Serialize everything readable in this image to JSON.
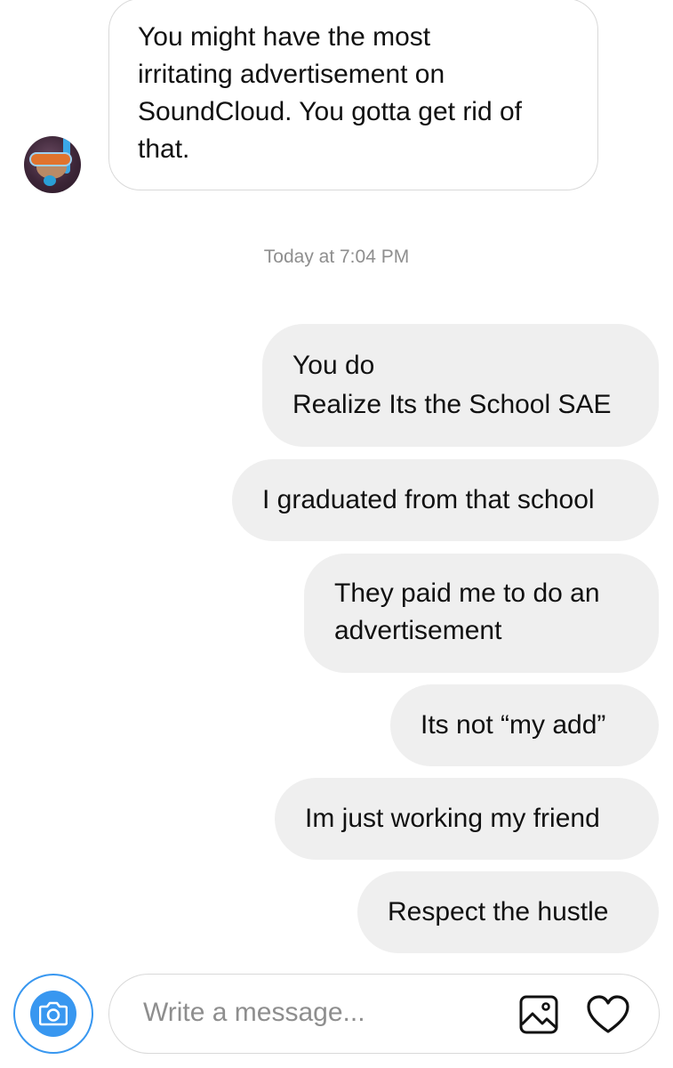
{
  "conversation": {
    "incoming": {
      "text": "You might have the most\nirritating advertisement on\nSoundCloud. You gotta get rid of\nthat.",
      "avatar": "user-avatar-snorkel"
    },
    "timestamp": "Today at 7:04 PM",
    "outgoing": [
      {
        "text": "You do\nRealize Its the School SAE"
      },
      {
        "text": "I graduated from that school"
      },
      {
        "text": "They paid me to do an\nadvertisement"
      },
      {
        "text": "Its not “my add”"
      },
      {
        "text": "Im just working my friend"
      },
      {
        "text": "Respect the hustle"
      }
    ]
  },
  "composer": {
    "placeholder": "Write a message...",
    "camera_icon": "camera-icon",
    "gallery_icon": "image-icon",
    "like_icon": "heart-icon"
  },
  "colors": {
    "accent": "#3897f0",
    "bubble_out": "#efefef",
    "border": "#d9d9d9",
    "muted_text": "#8e8e8e"
  }
}
